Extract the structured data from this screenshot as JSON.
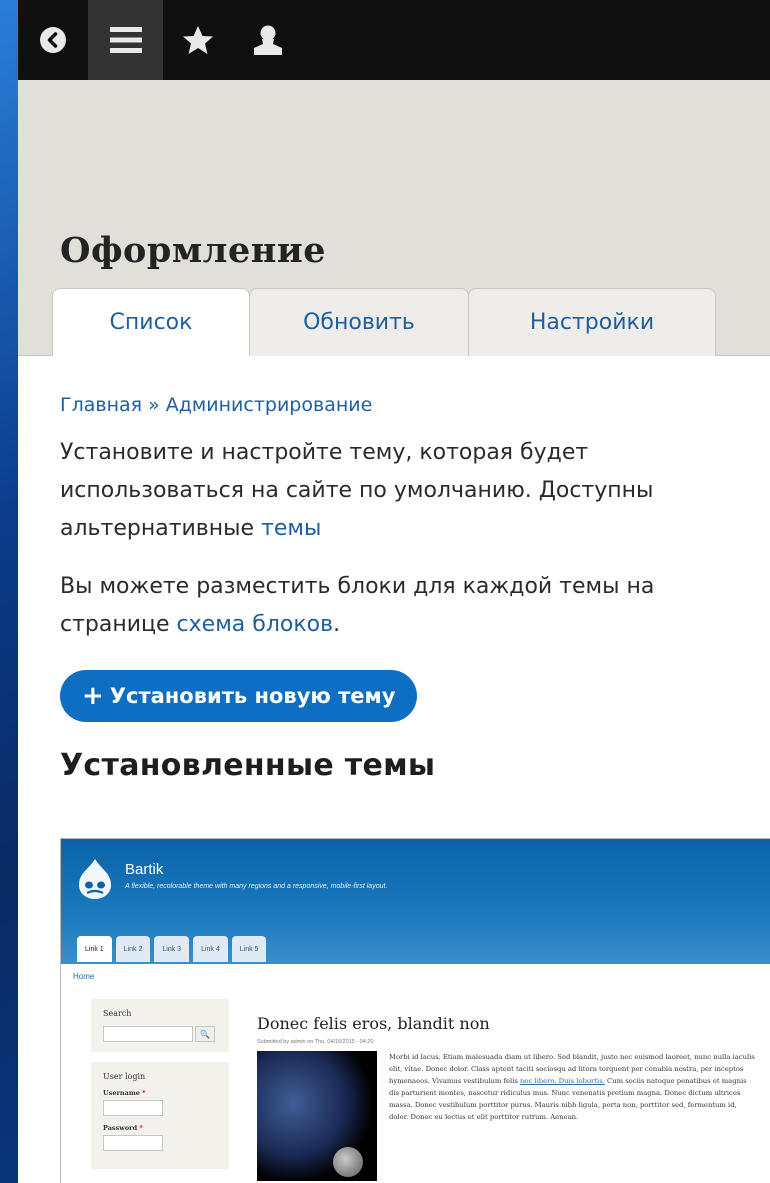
{
  "toolbar": {
    "items": [
      {
        "icon": "back-arrow-icon"
      },
      {
        "icon": "menu-icon"
      },
      {
        "icon": "star-icon"
      },
      {
        "icon": "user-icon"
      }
    ]
  },
  "header": {
    "title": "Оформление",
    "favorite_icon": "star-outline-icon"
  },
  "tabs": [
    {
      "label": "Список",
      "active": true
    },
    {
      "label": "Обновить",
      "active": false
    },
    {
      "label": "Настройки",
      "active": false
    }
  ],
  "breadcrumb": {
    "home": "Главная",
    "separator": "»",
    "admin": "Администрирование"
  },
  "intro": {
    "text": "Установите и настройте тему, которая будет использоваться на сайте по умолчанию. Доступны альтернативные ",
    "link": "темы"
  },
  "blocks_note": {
    "text": "Вы можете разместить блоки для каждой темы на странице ",
    "link": "схема блоков",
    "end": "."
  },
  "install_button": {
    "plus": "+",
    "label": "Установить новую тему"
  },
  "installed_title": "Установленные темы",
  "theme_preview": {
    "site_name": "Bartik",
    "slogan": "A flexible, recolorable theme with many regions and a responsive, mobile-first layout.",
    "tabs": [
      "Link 1",
      "Link 2",
      "Link 3",
      "Link 4",
      "Link 5"
    ],
    "home_link": "Home",
    "search_title": "Search",
    "search_button": "🔍",
    "login_title": "User login",
    "username_label": "Username",
    "password_label": "Password",
    "required_mark": "*",
    "article_title": "Donec felis eros, blandit non",
    "article_meta": "Submitted by admin on Thu, 04/16/2015 - 04:20",
    "article_text_1": "Morbi id lacus. Etiam malesuada diam ut libero. Sed blandit, justo nec euismod laoreet, nunc nulla iaculis elit, vitae. Donec dolor. Class aptent taciti sociosqu ad litora torquent per conubia nostra, per inceptos hymenaeos. Vivamus vestibulum felis ",
    "article_link": "nec libero. Duis lobortis.",
    "article_text_2": " Cum sociis natoque penatibus et magnis dis parturient montes, nascetur ridiculus mus. Nunc venenatis pretium magna. Donec dictum ultrices massa. Donec vestibulum porttitor purus. Mauris nibh ligula, porta non, porttitor sed, fermentum id, dolor. Donec eu lectus et elit porttitor rutrum. Aenean."
  }
}
